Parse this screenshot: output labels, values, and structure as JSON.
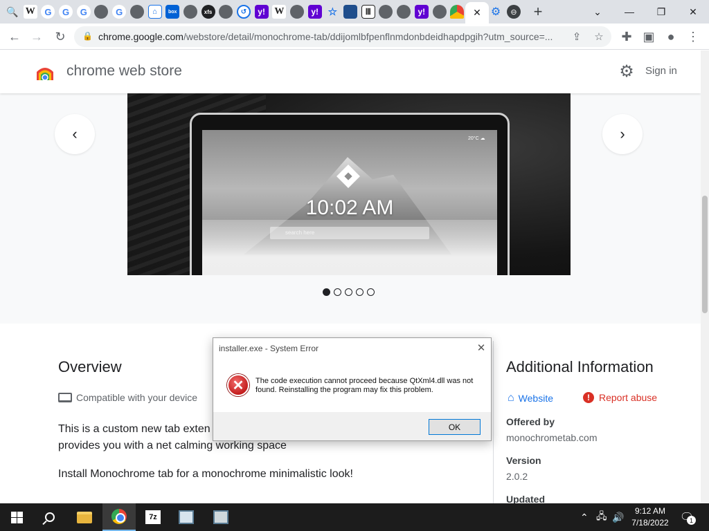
{
  "tabs": {
    "icons": [
      "search-icon",
      "wikipedia-icon",
      "google-icon",
      "google-icon",
      "google-icon",
      "globe-icon",
      "google-icon",
      "globe-icon",
      "home-icon",
      "box-icon",
      "globe-icon",
      "xfs-icon",
      "globe-icon",
      "history-icon",
      "yahoo-icon",
      "wikipedia-icon",
      "globe-icon",
      "yahoo-icon",
      "star-icon",
      "document-icon",
      "bank-icon",
      "globe-icon",
      "globe-icon",
      "yahoo-icon",
      "duck-icon",
      "chrome-web-store-icon"
    ],
    "glyphs": {
      "search": "🔍",
      "w": "W",
      "g": "G",
      "box": "box",
      "xfs": "xfs",
      "y": "y!",
      "star": "☆",
      "bank": "Ⅲ",
      "hist": "↺"
    },
    "active_close": "✕",
    "new_tab": "+",
    "window_controls": {
      "dropdown": "⌄",
      "minimize": "—",
      "restore": "❐",
      "close": "✕"
    }
  },
  "toolbar": {
    "back": "←",
    "forward": "→",
    "reload": "↻",
    "url_host": "chrome.google.com",
    "url_path": "/webstore/detail/monochrome-tab/ddijomlbfpenflnmdonbdeidhapdpgih?utm_source=...",
    "share_icon": "⇪",
    "bookmark_icon": "☆",
    "extensions_icon": "✚",
    "sidepanel_icon": "▣",
    "profile_icon": "●",
    "menu_icon": "⋮"
  },
  "store": {
    "title": "chrome web store",
    "signin": "Sign in",
    "gear": "⚙"
  },
  "carousel": {
    "clock": "10:02 AM",
    "search_placeholder": "search here",
    "weather": "20°C ☁",
    "prev": "‹",
    "next": "›",
    "dots": 5,
    "active_dot": 0
  },
  "overview": {
    "title": "Overview",
    "compat": "Compatible with your device",
    "desc_line1": "This is a custom new tab exten",
    "desc_line2": "provides you with a net calming working space",
    "install": "Install Monochrome tab for a monochrome minimalistic look!"
  },
  "additional": {
    "title": "Additional Information",
    "website": "Website",
    "report": "Report abuse",
    "offered_label": "Offered by",
    "offered_value": "monochrometab.com",
    "version_label": "Version",
    "version_value": "2.0.2",
    "updated_label": "Updated"
  },
  "dialog": {
    "title": "installer.exe - System Error",
    "close": "✕",
    "icon": "✕",
    "message": "The code execution cannot proceed because QtXml4.dll was not found. Reinstalling the program may fix this problem.",
    "ok": "OK"
  },
  "taskbar": {
    "sevenz": "7z",
    "tray_chevron": "⌃",
    "network": "🖧",
    "volume": "🔊",
    "time": "9:12 AM",
    "date": "7/18/2022",
    "notifications": "🗨",
    "notif_count": "1"
  }
}
